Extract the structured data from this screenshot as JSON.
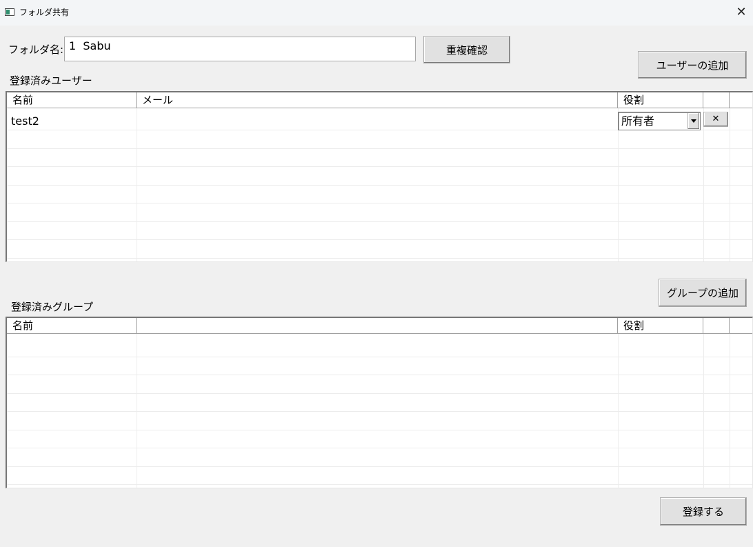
{
  "window": {
    "title": "フォルダ共有",
    "close_glyph": "✕"
  },
  "folder": {
    "label": "フォルダ名:",
    "value": "1  Sabu",
    "check_button": "重複確認"
  },
  "users": {
    "add_button": "ユーザーの追加",
    "section_label": "登録済みユーザー",
    "columns": [
      "名前",
      "メール",
      "役割"
    ],
    "rows": [
      {
        "name": "test2",
        "email": "",
        "role": "所有者",
        "delete_glyph": "✕"
      }
    ]
  },
  "groups": {
    "add_button": "グループの追加",
    "section_label": "登録済みグループ",
    "columns": [
      "名前",
      "",
      "役割"
    ]
  },
  "footer": {
    "register_button": "登録する"
  },
  "icons": {
    "app": "window-app-icon",
    "close": "close-icon",
    "dropdown": "chevron-down-icon",
    "delete": "close-icon"
  }
}
